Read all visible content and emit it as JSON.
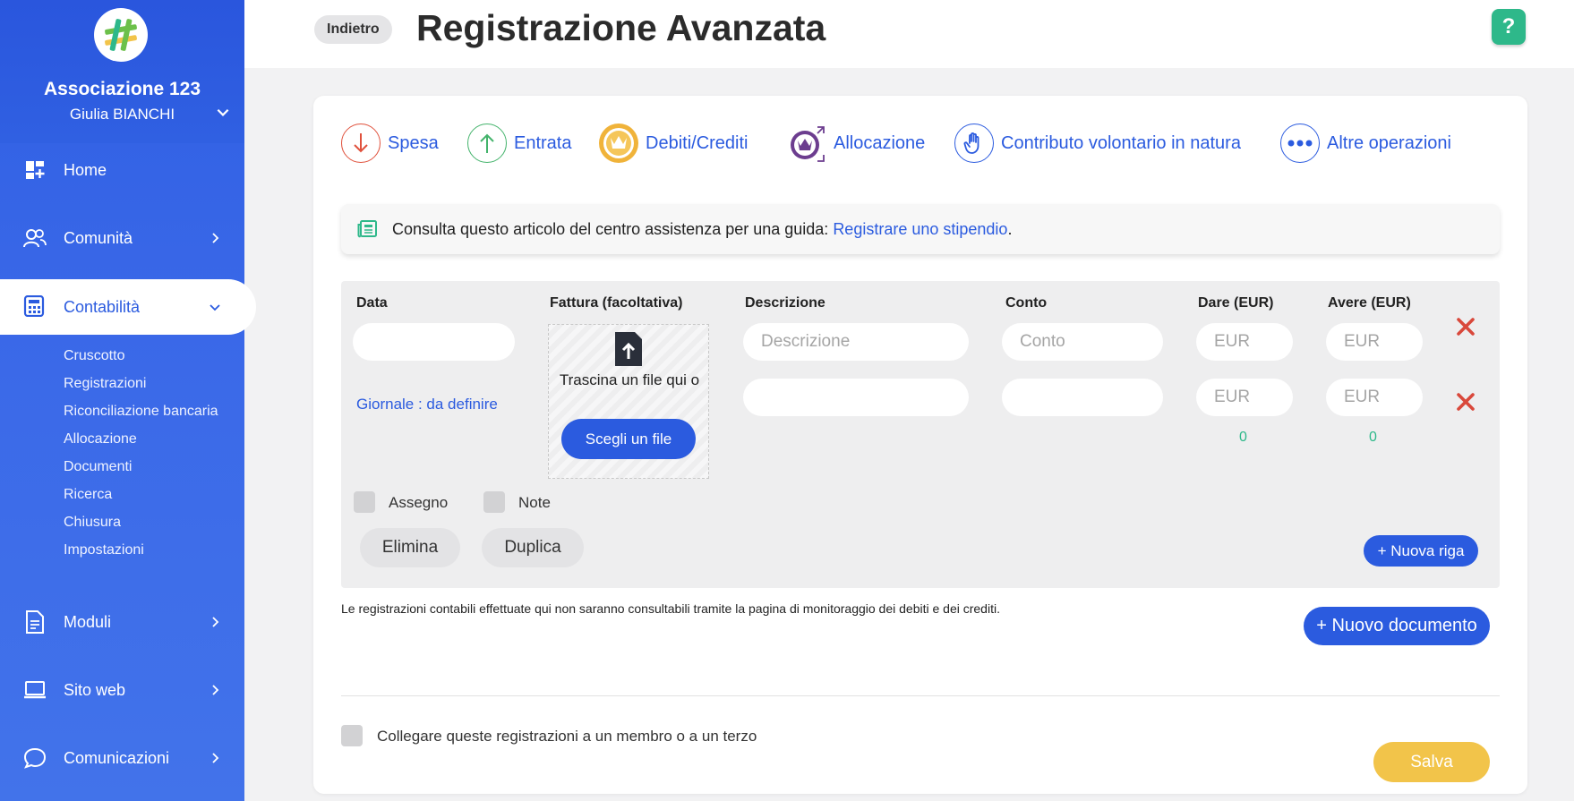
{
  "sidebar": {
    "org_name": "Associazione 123",
    "user_name": "Giulia BIANCHI",
    "items": [
      {
        "label": "Home",
        "icon": "dashboard-icon"
      },
      {
        "label": "Comunità",
        "icon": "users-icon"
      },
      {
        "label": "Contabilità",
        "icon": "calculator-icon"
      },
      {
        "label": "Moduli",
        "icon": "document-icon"
      },
      {
        "label": "Sito web",
        "icon": "laptop-icon"
      },
      {
        "label": "Comunicazioni",
        "icon": "chat-icon"
      }
    ],
    "subitems": [
      "Cruscotto",
      "Registrazioni",
      "Riconciliazione bancaria",
      "Allocazione",
      "Documenti",
      "Ricerca",
      "Chiusura",
      "Impostazioni"
    ]
  },
  "header": {
    "back_label": "Indietro",
    "title": "Registrazione Avanzata",
    "help_label": "?"
  },
  "operations": [
    {
      "label": "Spesa",
      "icon": "arrow-down-icon",
      "color": "#e0513c"
    },
    {
      "label": "Entrata",
      "icon": "arrow-up-icon",
      "color": "#43b36b"
    },
    {
      "label": "Debiti/Crediti",
      "icon": "crown-icon",
      "color": "#f0b33a"
    },
    {
      "label": "Allocazione",
      "icon": "crown-arrows-icon",
      "color": "#6c3d8f"
    },
    {
      "label": "Contributo volontario in natura",
      "icon": "hand-icon",
      "color": "#2b5bdf"
    },
    {
      "label": "Altre operazioni",
      "icon": "more-icon",
      "color": "#2b5bdf"
    }
  ],
  "info": {
    "text": "Consulta questo articolo del centro assistenza per una guida: ",
    "link": "Registrare uno stipendio",
    "end": "."
  },
  "entry": {
    "columns": {
      "data": "Data",
      "fattura": "Fattura (facoltativa)",
      "descrizione": "Descrizione",
      "conto": "Conto",
      "dare": "Dare (EUR)",
      "avere": "Avere (EUR)"
    },
    "placeholders": {
      "descrizione": "Descrizione",
      "conto": "Conto",
      "eur": "EUR"
    },
    "journal": "Giornale : da definire",
    "drop_text": "Trascina un file qui o",
    "choose_file": "Scegli un file",
    "total_dare": "0",
    "total_avere": "0",
    "check_assegno": "Assegno",
    "check_note": "Note",
    "btn_elimina": "Elimina",
    "btn_duplica": "Duplica",
    "btn_nuova_riga": "+ Nuova riga"
  },
  "footer": {
    "note": "Le registrazioni contabili effettuate qui non saranno consultabili tramite la pagina di monitoraggio dei debiti e dei crediti.",
    "new_document": "+ Nuovo documento",
    "link_member": "Collegare queste registrazioni a un membro o a un terzo",
    "save": "Salva"
  },
  "colors": {
    "primary": "#2b5bdf",
    "accent_green": "#2eb88a",
    "save_yellow": "#f2c44a",
    "delete_red": "#d9483b"
  }
}
